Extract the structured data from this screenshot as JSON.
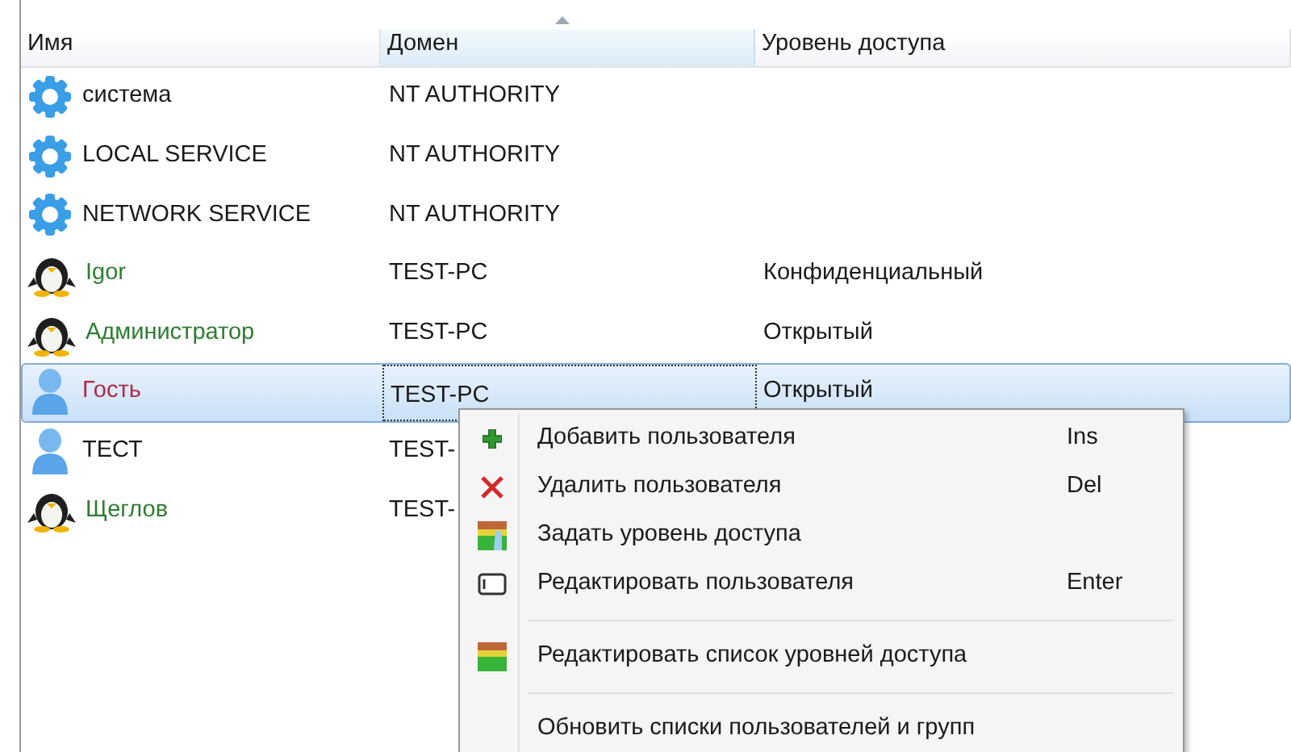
{
  "table": {
    "columns": [
      {
        "label": "Имя",
        "sorted": false
      },
      {
        "label": "Домен",
        "sorted": true
      },
      {
        "label": "Уровень доступа",
        "sorted": false
      }
    ],
    "rows": [
      {
        "kind": "service",
        "name": "система",
        "color": "#1a1a1a",
        "domain": "NT AUTHORITY",
        "selected": false
      },
      {
        "kind": "service",
        "name": "LOCAL SERVICE",
        "color": "#1a1a1a",
        "domain": "NT AUTHORITY",
        "selected": false
      },
      {
        "kind": "service",
        "name": "NETWORK SERVICE",
        "color": "#1a1a1a",
        "domain": "NT AUTHORITY",
        "selected": false
      },
      {
        "kind": "penguin",
        "name": "Igor",
        "color": "#2e7d32",
        "domain": "TEST-PC",
        "access": "Конфиденциальный",
        "selected": false
      },
      {
        "kind": "penguin",
        "name": "Администратор",
        "color": "#2e7d32",
        "domain": "TEST-PC",
        "access": "Открытый",
        "selected": false
      },
      {
        "kind": "person",
        "name": "Гость",
        "color": "#b02848",
        "domain": "TEST-PC",
        "access": "Открытый",
        "selected": true
      },
      {
        "kind": "person",
        "name": "ТЕСТ",
        "color": "#1a1a1a",
        "domain": "TEST-",
        "selected": false
      },
      {
        "kind": "penguin",
        "name": "Щеглов",
        "color": "#2e7d32",
        "domain": "TEST-",
        "selected": false
      }
    ]
  },
  "context_menu": {
    "items": [
      {
        "kind": "add",
        "label": "Добавить пользователя",
        "shortcut": "Ins"
      },
      {
        "kind": "delete",
        "label": "Удалить пользователя",
        "shortcut": "Del"
      },
      {
        "kind": "access",
        "label": "Задать уровень доступа"
      },
      {
        "kind": "edit",
        "label": "Редактировать пользователя",
        "shortcut": "Enter"
      },
      {
        "kind": "separator"
      },
      {
        "kind": "levels",
        "label": "Редактировать список уровней доступа"
      },
      {
        "kind": "separator"
      },
      {
        "kind": "plain",
        "label": "Обновить списки пользователей и групп"
      }
    ]
  }
}
